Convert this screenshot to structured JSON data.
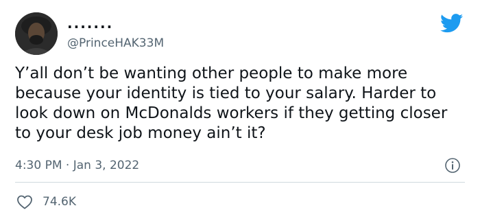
{
  "tweet": {
    "display_name": ".......",
    "handle": "@PrinceHAK33M",
    "text": "Y’all don’t be wanting other people to make more because your identity is tied to your salary. Harder to look down on McDonalds workers if they getting closer to your desk job money ain’t it?",
    "timestamp": "4:30 PM · Jan 3, 2022",
    "likes": "74.6K"
  },
  "colors": {
    "twitter_blue": "#1d9bf0",
    "secondary_text": "#536471",
    "divider": "#cfd9de"
  },
  "icons": {
    "brand": "twitter-bird-icon",
    "info": "info-icon",
    "like": "heart-icon"
  }
}
